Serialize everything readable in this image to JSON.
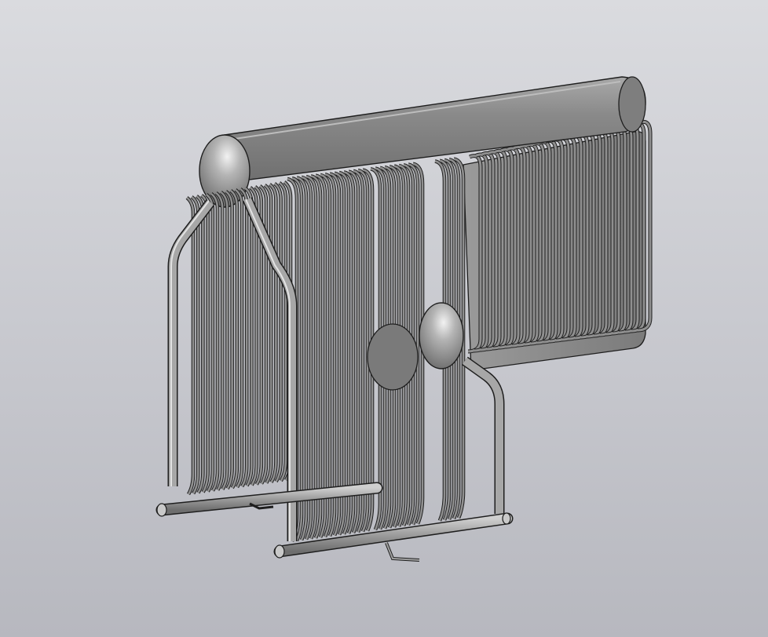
{
  "viewport": {
    "background_top": "#dadbdf",
    "background_bottom": "#b7b8bf"
  },
  "model": {
    "shade_color": "#8f8f8f",
    "edge_color": "#1e1e1e",
    "highlight_color": "#e6e6e6"
  }
}
